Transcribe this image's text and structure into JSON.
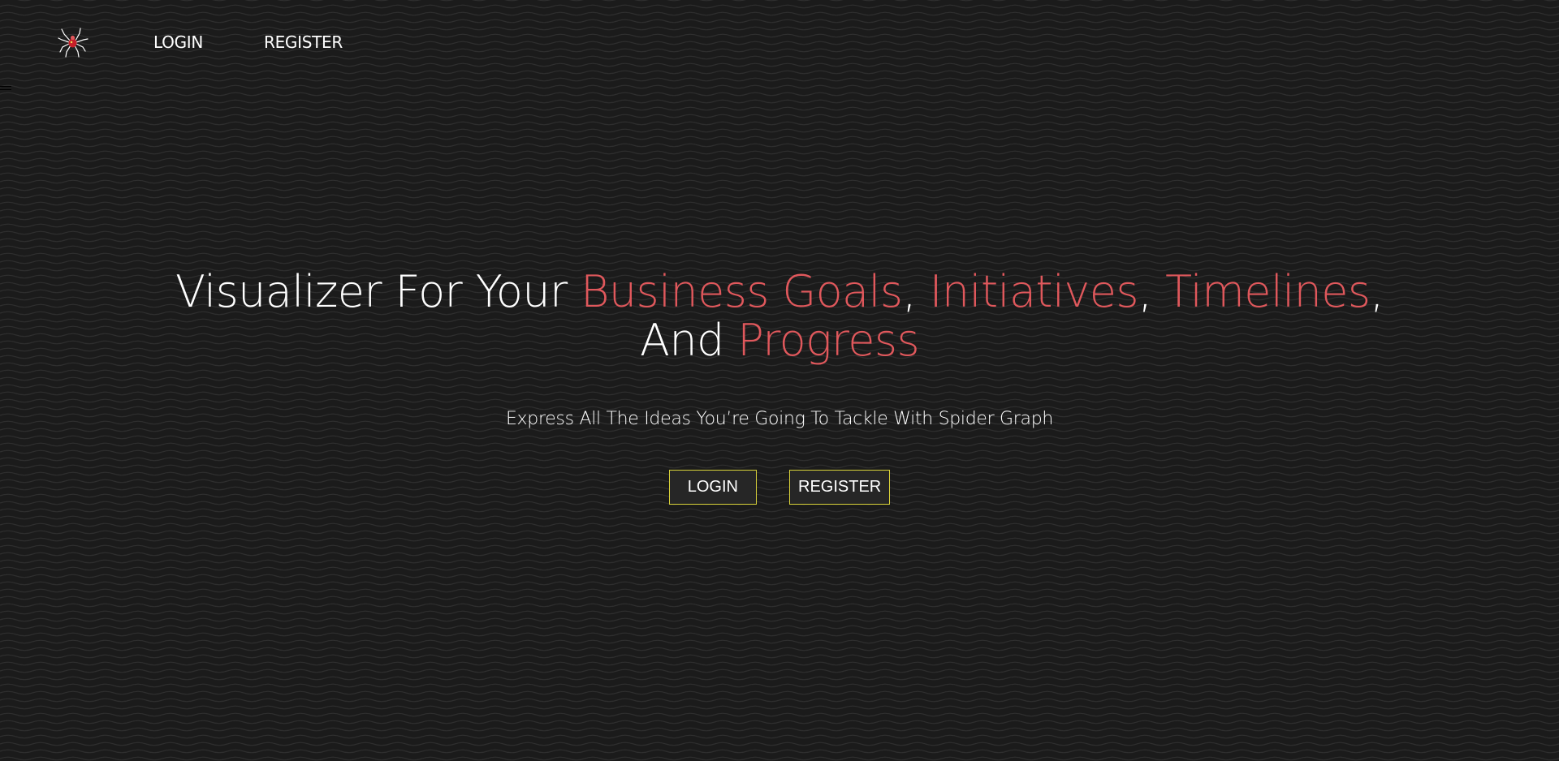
{
  "colors": {
    "background": "#1b1b1b",
    "wave_line": "#2e2e2e",
    "accent": "#e0585c",
    "button_border": "#d9d23a",
    "button_fill": "#262626",
    "text": "#ffffff"
  },
  "nav": {
    "logo_icon": "spider-icon",
    "login_label": "LOGIN",
    "register_label": "REGISTER",
    "menu_icon": "hamburger-icon"
  },
  "hero": {
    "headline": {
      "part1": "Visualizer For Your ",
      "accent1": "Business Goals",
      "sep1": ", ",
      "accent2": "Initiatives",
      "sep2": ", ",
      "accent3": "Timelines",
      "sep3": ",",
      "part2": "And ",
      "accent4": "Progress"
    },
    "subtitle": "Express All The Ideas You’re Going To Tackle With Spider Graph",
    "login_button": "LOGIN",
    "register_button": "REGISTER"
  }
}
